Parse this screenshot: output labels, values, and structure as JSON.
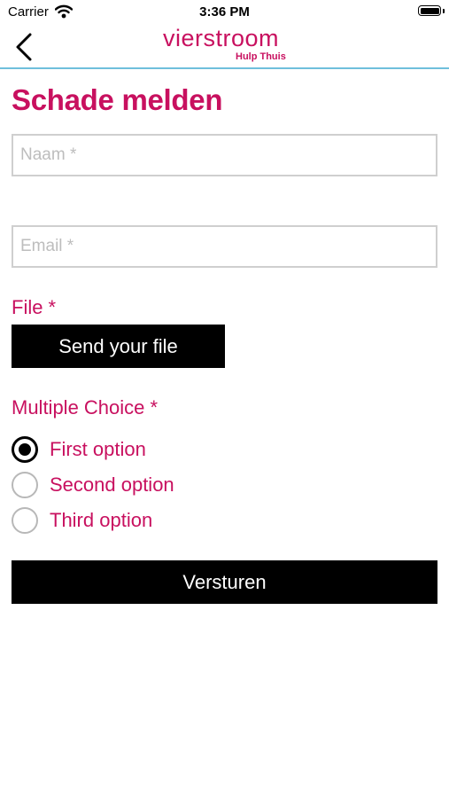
{
  "status_bar": {
    "carrier": "Carrier",
    "time": "3:36 PM"
  },
  "navbar": {
    "back_icon": "chevron-left-icon",
    "logo_text": "vierstroom",
    "logo_tagline": "Hulp Thuis"
  },
  "page": {
    "title": "Schade melden"
  },
  "form": {
    "name_placeholder": "Naam *",
    "email_placeholder": "Email *",
    "file_label": "File *",
    "file_button_label": "Send your file",
    "choice_label": "Multiple Choice *",
    "options": [
      {
        "label": "First option",
        "selected": true
      },
      {
        "label": "Second option",
        "selected": false
      },
      {
        "label": "Third option",
        "selected": false
      }
    ],
    "submit_label": "Versturen"
  },
  "colors": {
    "brand": "#c8105f",
    "navbar_divider": "#6fbfdc",
    "button_bg": "#000000"
  }
}
